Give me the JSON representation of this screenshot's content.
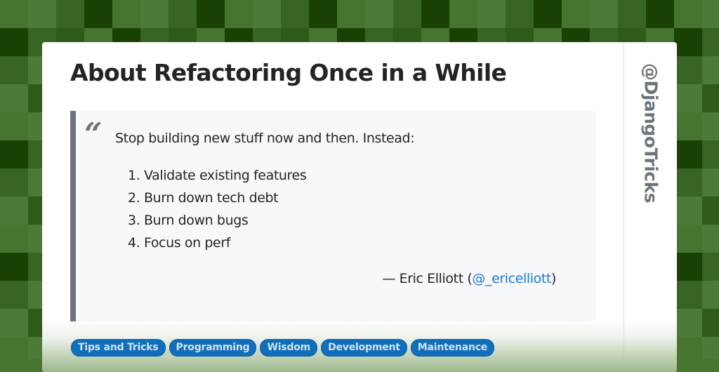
{
  "background": {
    "pattern": "green-pixel-checker",
    "palette": [
      "#46752f",
      "#4c7a38",
      "#386424",
      "#1a4104",
      "#2f5a1a"
    ]
  },
  "post": {
    "title": "About Refactoring Once in a While",
    "quote_icon": "open-quote-icon",
    "quote_lead": "Stop building new stuff now and then. Instead:",
    "list_items": [
      "1. Validate existing features",
      "2. Burn down tech debt",
      "3. Burn down bugs",
      "4. Focus on perf"
    ],
    "attribution_prefix": "— Eric Elliott (",
    "attribution_handle": "@_ericelliott",
    "attribution_suffix": ")"
  },
  "sidebar": {
    "handle": "@DjangoTricks"
  },
  "tags": [
    "Tips and Tricks",
    "Programming",
    "Wisdom",
    "Development",
    "Maintenance"
  ],
  "colors": {
    "accent_link": "#1a7ad6",
    "tag_bg": "#0f6fbd",
    "quote_border": "#6c757d",
    "title": "#212529"
  }
}
